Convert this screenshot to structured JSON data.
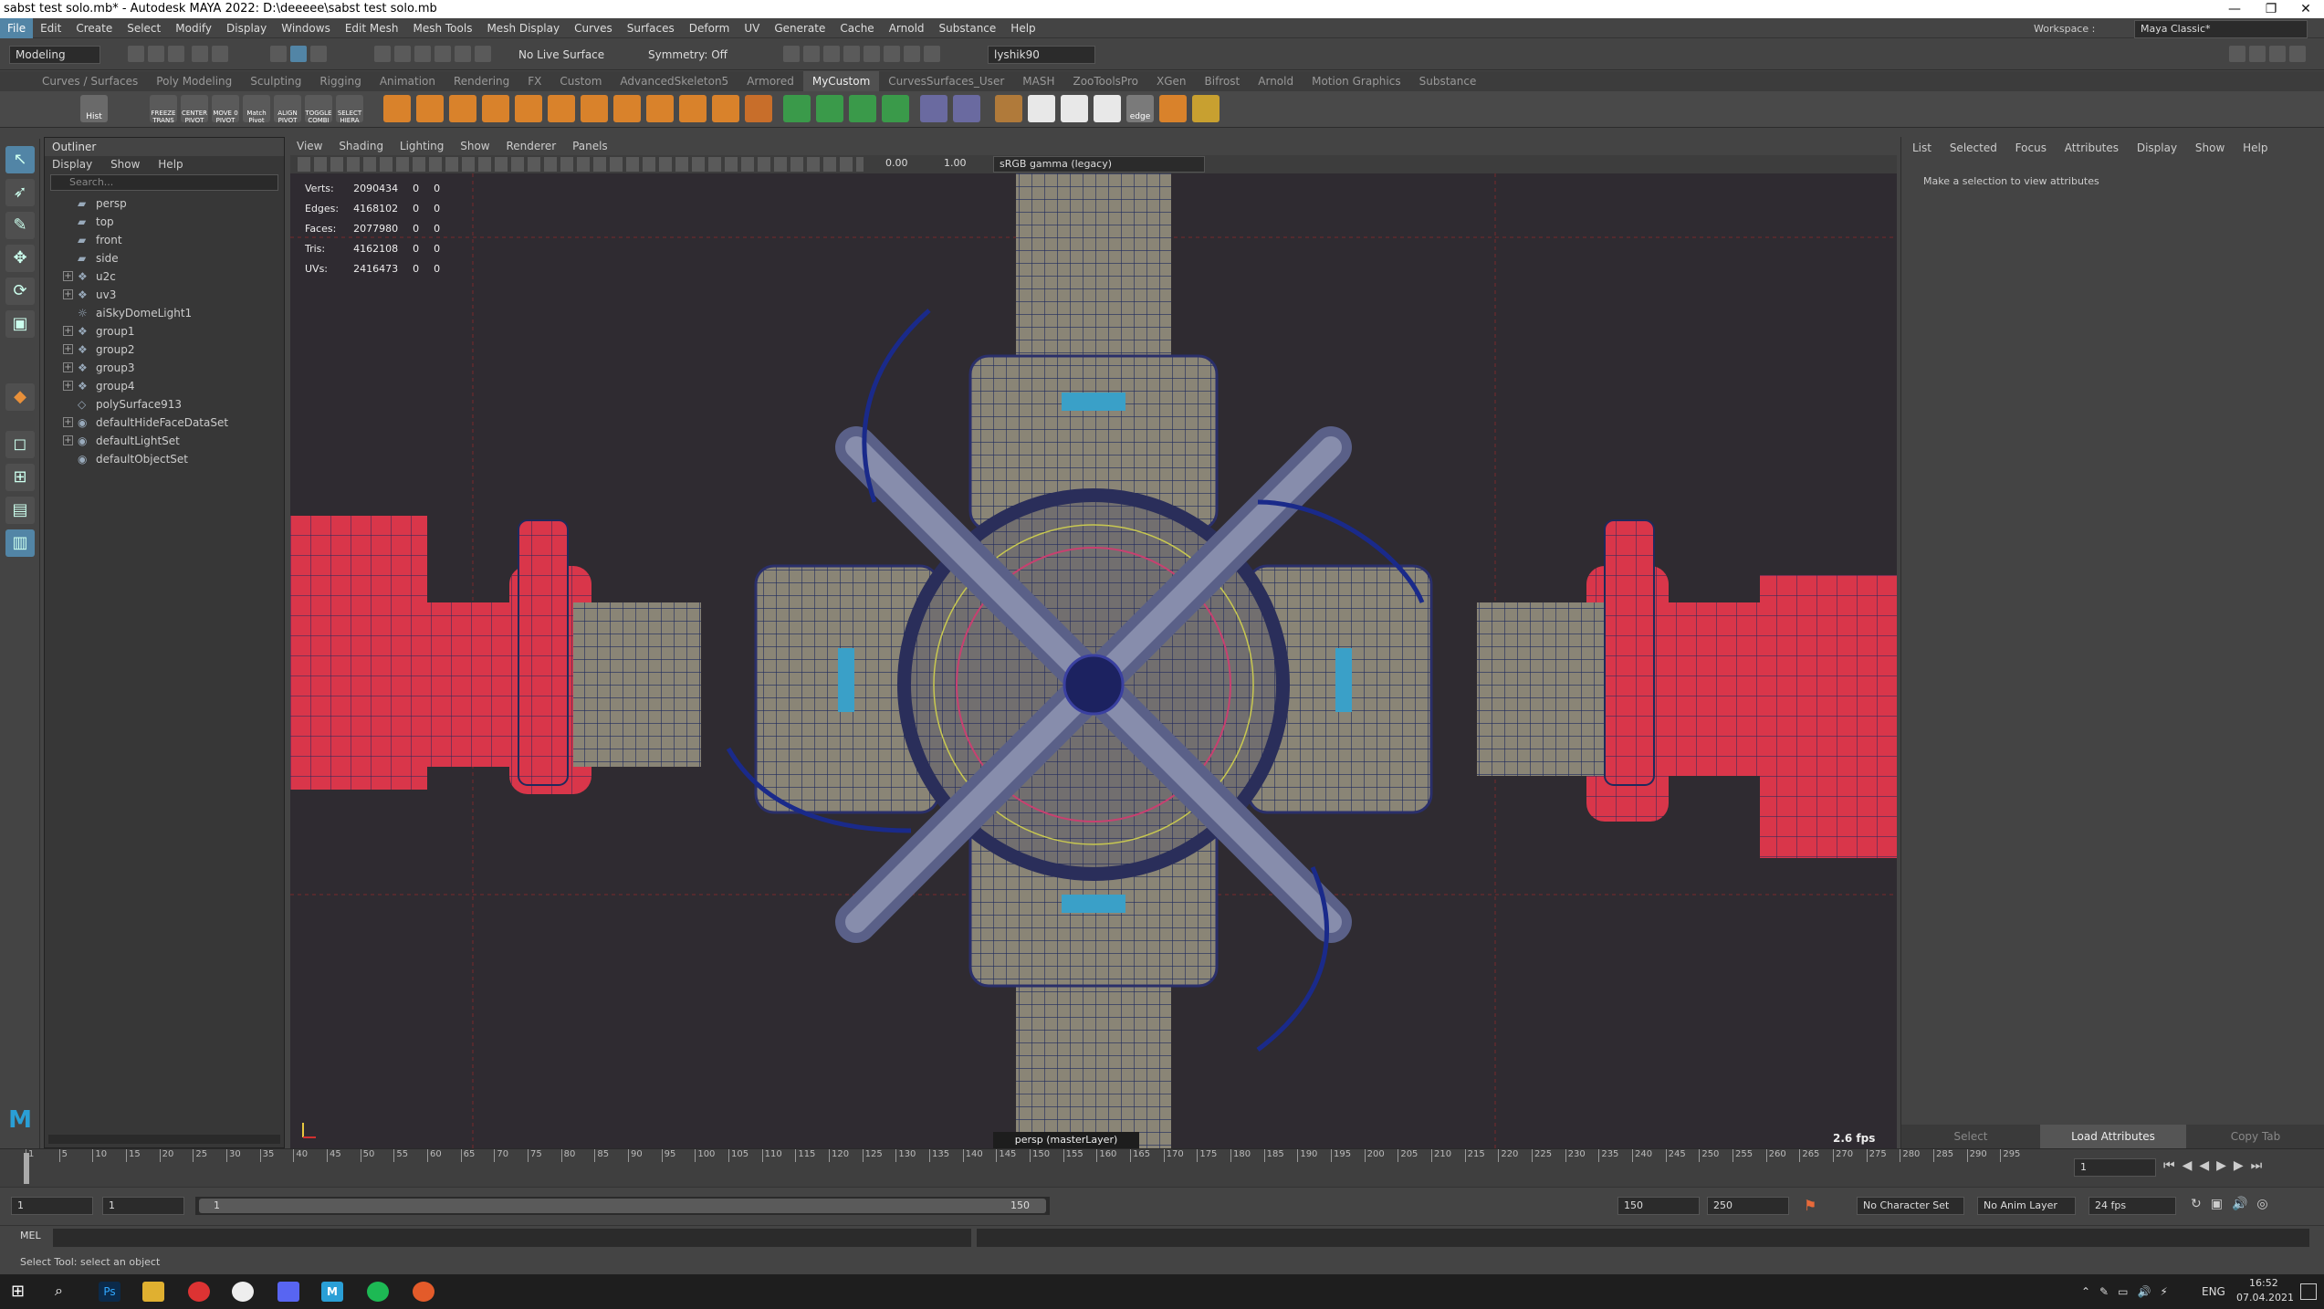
{
  "window": {
    "title": "sabst test solo.mb* - Autodesk MAYA 2022: D:\\deeeee\\sabst test solo.mb"
  },
  "menu": [
    "File",
    "Edit",
    "Create",
    "Select",
    "Modify",
    "Display",
    "Windows",
    "Edit Mesh",
    "Mesh Tools",
    "Mesh Display",
    "Curves",
    "Surfaces",
    "Deform",
    "UV",
    "Generate",
    "Cache",
    "Arnold",
    "Substance",
    "Help"
  ],
  "workspace": {
    "label": "Workspace :",
    "value": "Maya Classic*"
  },
  "statusline": {
    "mode": "Modeling",
    "live_surface": "No Live Surface",
    "symmetry": "Symmetry: Off",
    "user": "lyshik90"
  },
  "shelf_tabs": [
    "Curves / Surfaces",
    "Poly Modeling",
    "Sculpting",
    "Rigging",
    "Animation",
    "Rendering",
    "FX",
    "Custom",
    "AdvancedSkeleton5",
    "Armored",
    "MyCustom",
    "CurvesSurfaces_User",
    "MASH",
    "ZooToolsPro",
    "XGen",
    "Bifrost",
    "Arnold",
    "Motion Graphics",
    "Substance"
  ],
  "shelf_active": "MyCustom",
  "shelf_labels": [
    "Hist",
    "FREEZE TRANS",
    "CENTER PIVOT",
    "MOVE 0 PIVOT",
    "Match Pivot",
    "ALIGN PIVOT",
    "TOGGLE COMBI",
    "SELECT HIERA",
    "edge"
  ],
  "outliner": {
    "title": "Outliner",
    "menu": [
      "Display",
      "Show",
      "Help"
    ],
    "search_placeholder": "Search...",
    "items": [
      {
        "label": "persp",
        "icon": "camera-icon",
        "expand": false
      },
      {
        "label": "top",
        "icon": "camera-icon",
        "expand": false
      },
      {
        "label": "front",
        "icon": "camera-icon",
        "expand": false
      },
      {
        "label": "side",
        "icon": "camera-icon",
        "expand": false
      },
      {
        "label": "u2c",
        "icon": "group-icon",
        "expand": true
      },
      {
        "label": "uv3",
        "icon": "group-icon",
        "expand": true
      },
      {
        "label": "aiSkyDomeLight1",
        "icon": "light-icon",
        "expand": false
      },
      {
        "label": "group1",
        "icon": "group-icon",
        "expand": true
      },
      {
        "label": "group2",
        "icon": "group-icon",
        "expand": true
      },
      {
        "label": "group3",
        "icon": "group-icon",
        "expand": true
      },
      {
        "label": "group4",
        "icon": "group-icon",
        "expand": true
      },
      {
        "label": "polySurface913",
        "icon": "mesh-icon",
        "expand": false
      },
      {
        "label": "defaultHideFaceDataSet",
        "icon": "set-icon",
        "expand": true
      },
      {
        "label": "defaultLightSet",
        "icon": "set-icon",
        "expand": true
      },
      {
        "label": "defaultObjectSet",
        "icon": "set-icon",
        "expand": false
      }
    ]
  },
  "viewport": {
    "menu": [
      "View",
      "Shading",
      "Lighting",
      "Show",
      "Renderer",
      "Panels"
    ],
    "exposure": "0.00",
    "gamma": "1.00",
    "colorspace": "sRGB gamma (legacy)",
    "camera_label": "persp (masterLayer)",
    "fps": "2.6 fps",
    "hud": [
      {
        "label": "Verts:",
        "a": "2090434",
        "b": "0",
        "c": "0"
      },
      {
        "label": "Edges:",
        "a": "4168102",
        "b": "0",
        "c": "0"
      },
      {
        "label": "Faces:",
        "a": "2077980",
        "b": "0",
        "c": "0"
      },
      {
        "label": "Tris:",
        "a": "4162108",
        "b": "0",
        "c": "0"
      },
      {
        "label": "UVs:",
        "a": "2416473",
        "b": "0",
        "c": "0"
      }
    ]
  },
  "attribute_editor": {
    "menu": [
      "List",
      "Selected",
      "Focus",
      "Attributes",
      "Display",
      "Show",
      "Help"
    ],
    "message": "Make a selection to view attributes",
    "select": "Select",
    "load": "Load Attributes",
    "copy": "Copy Tab"
  },
  "timeline": {
    "ticks": [
      "1",
      "5",
      "10",
      "15",
      "20",
      "25",
      "30",
      "35",
      "40",
      "45",
      "50",
      "55",
      "60",
      "65",
      "70",
      "75",
      "80",
      "85",
      "90",
      "95",
      "100",
      "105",
      "110",
      "115",
      "120",
      "125",
      "130",
      "135",
      "140",
      "145",
      "150",
      "155",
      "160",
      "165",
      "170",
      "175",
      "180",
      "185",
      "190",
      "195",
      "200",
      "205",
      "210",
      "215",
      "220",
      "225",
      "230",
      "235",
      "240",
      "245",
      "250",
      "255",
      "260",
      "265",
      "270",
      "275",
      "280",
      "285",
      "290",
      "295"
    ],
    "current": "1"
  },
  "range": {
    "start_outer": "1",
    "start": "1",
    "slider_start": "1",
    "slider_end": "150",
    "end": "150",
    "end_outer": "250",
    "character": "No Character Set",
    "anim_layer": "No Anim Layer",
    "fps": "24 fps"
  },
  "cmdline": {
    "label": "MEL"
  },
  "help_line": "Select Tool: select an object",
  "taskbar": {
    "lang": "ENG",
    "time": "16:52",
    "date": "07.04.2021"
  }
}
